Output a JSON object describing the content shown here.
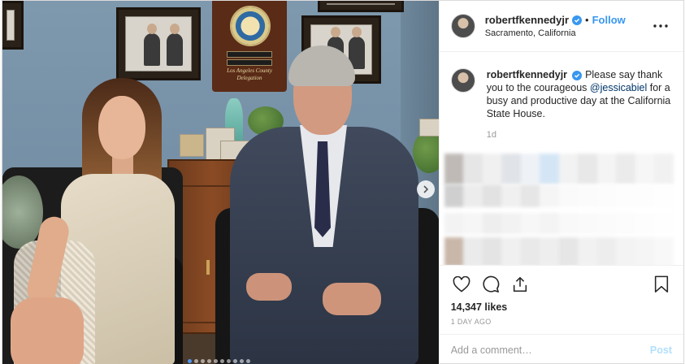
{
  "post": {
    "username": "robertfkennedyjr",
    "follow_label": "Follow",
    "separator": "•",
    "location": "Sacramento, California",
    "more_icon_text": "•••"
  },
  "photo": {
    "plaque_caption": "Los Angeles County Delegation",
    "carousel": {
      "total_dots": 10,
      "active_index": 0
    },
    "next_icon": "chevron-right-icon"
  },
  "caption": {
    "username": "robertfkennedyjr",
    "text_before": "Please say thank you to the courageous ",
    "mention": "@jessicabiel",
    "text_after": " for a busy and productive day at the California State House.",
    "time": "1d"
  },
  "actions": {
    "icons": [
      "heart-icon",
      "comment-icon",
      "share-icon",
      "bookmark-icon"
    ],
    "likes": "14,347 likes",
    "posted": "1 DAY AGO"
  },
  "comment_box": {
    "placeholder": "Add a comment…",
    "post_label": "Post"
  },
  "colors": {
    "accent": "#3897f0",
    "mention": "#003569",
    "muted": "#999999",
    "post_disabled": "#b2dffc"
  }
}
